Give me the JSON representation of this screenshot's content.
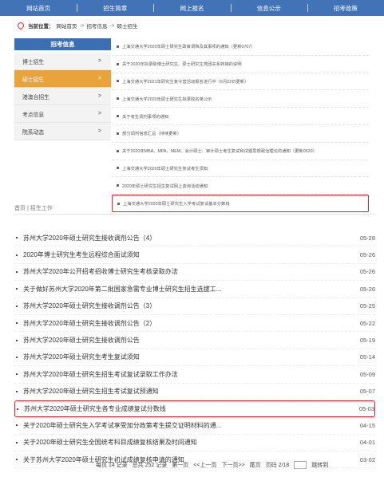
{
  "topnav": {
    "items": [
      "网站首页",
      "招生简章",
      "网上报名",
      "信息公示",
      "招考政策"
    ]
  },
  "breadcrumb": {
    "label": "当前位置：",
    "items": [
      "网站首页",
      "招考信息",
      "硕士招生"
    ],
    "sep": "->"
  },
  "sidebar": {
    "title": "招考信息",
    "items": [
      {
        "label": "博士招生",
        "chev": ">"
      },
      {
        "label": "硕士招生",
        "chev": ">"
      },
      {
        "label": "港澳台招生",
        "chev": ">"
      },
      {
        "label": "考点信息",
        "chev": ">"
      },
      {
        "label": "院系动态",
        "chev": ">"
      }
    ]
  },
  "newslist": {
    "items": [
      "上海交通大学2020年硕士研究生政审调档及其事项的通知（更新0707）",
      "关于2020年拟录取博士研究生、硕士研究生党团关系转接的说明",
      "上海交通大学2021年研究生复令营活动报名进行中（6月22日更新）",
      "上海交通大学2020年硕士研究生拟录取名单公示",
      "关于考生调剂事项的通知",
      "部分调剂信息汇总（持续更新）",
      "关于2020年MBA、MPA、MEM、会计硕士、审计硕士考生复试和试题思想政治理论的通知（更新0520）",
      "上海交通大学2020年硕士研究生复试考生须知",
      "2020年硕士研究生招生复试网上咨询活动通知",
      "上海交通大学2020年硕士研究生入学考试复试基本分数线"
    ]
  },
  "section": {
    "crumb": "首页 | 招生工作"
  },
  "articles": [
    {
      "title": "苏州大学2020年硕士研究生接收调剂公告（4）",
      "date": "05-28"
    },
    {
      "title": "2020年博士研究生考生远程综合面试须知",
      "date": "05-26"
    },
    {
      "title": "苏州大学2020年公开招考招收博士研究生考核录取办法",
      "date": "05-26"
    },
    {
      "title": "关于做好苏州大学2020年第二批国家急需专业博士研究生招生选拔工...",
      "date": "05-26"
    },
    {
      "title": "苏州大学2020年硕士研究生接收调剂公告（3）",
      "date": "05-25"
    },
    {
      "title": "苏州大学2020年硕士研究生接收调剂公告（2）",
      "date": "05-22"
    },
    {
      "title": "苏州大学2020年硕士研究生接收调剂公告",
      "date": "05-19"
    },
    {
      "title": "苏州大学2020年硕士研究生考生复试须知",
      "date": "05-14"
    },
    {
      "title": "苏州大学2020年硕士研究生招生考试复试录取工作办法",
      "date": "05-09"
    },
    {
      "title": "苏州大学2020年硕士研究生招生考试复试预通知",
      "date": "05-07"
    },
    {
      "title": "苏州大学2020年硕士研究生各专业成绩复试分数线",
      "date": "05-03"
    },
    {
      "title": "关于2020年硕士研究生入学考试享受加分政策考生提交证明材料的通...",
      "date": "04-15"
    },
    {
      "title": "关于2020年硕士研究生全国统考科目成绩复核结果及时间通知",
      "date": "04-01"
    },
    {
      "title": "关于苏州大学2020年硕士研究生初试成绩复核申请的通知",
      "date": "03-02"
    }
  ],
  "pager": {
    "page_size": "每页 14 记录",
    "total": "总共 252 记录",
    "first": "第一页",
    "prev": "<<上一页",
    "next": "下一页>>",
    "last": "尾页",
    "current": "页码 2/18",
    "jump": "跳转到"
  },
  "colors": {
    "nav": "#4173b6",
    "sidebar_title": "#3a6fb5",
    "sidebar_active": "#e8a33b",
    "highlight_box": "#d9232d"
  }
}
